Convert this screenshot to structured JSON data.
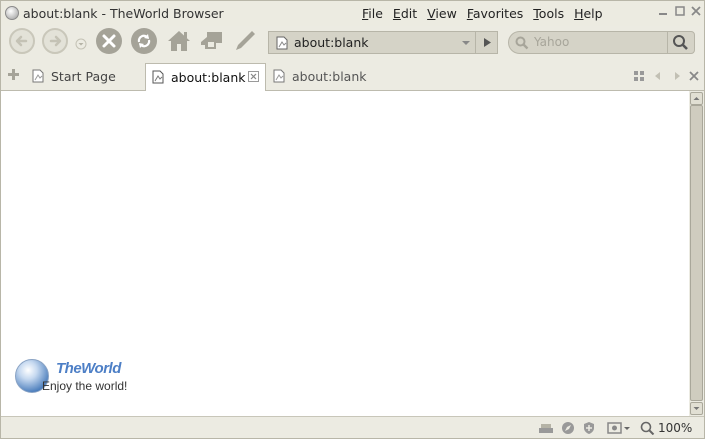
{
  "window": {
    "title": "about:blank - TheWorld Browser"
  },
  "menu": [
    {
      "key": "F",
      "rest": "ile"
    },
    {
      "key": "E",
      "rest": "dit"
    },
    {
      "key": "V",
      "rest": "iew"
    },
    {
      "key": "F",
      "rest": "avorites"
    },
    {
      "key": "T",
      "rest": "ools"
    },
    {
      "key": "H",
      "rest": "elp"
    }
  ],
  "address": {
    "value": "about:blank"
  },
  "search": {
    "placeholder": "Yahoo"
  },
  "tabs": [
    {
      "label": "Start Page"
    },
    {
      "label": "about:blank"
    },
    {
      "label": "about:blank"
    }
  ],
  "logo": {
    "brand": "TheWorld",
    "tagline": "Enjoy the world!"
  },
  "status": {
    "zoom": "100%"
  },
  "colors": {
    "chrome": "#ecebe2",
    "field": "#d5d3c7",
    "logo_blue": "#4d7fc6"
  }
}
